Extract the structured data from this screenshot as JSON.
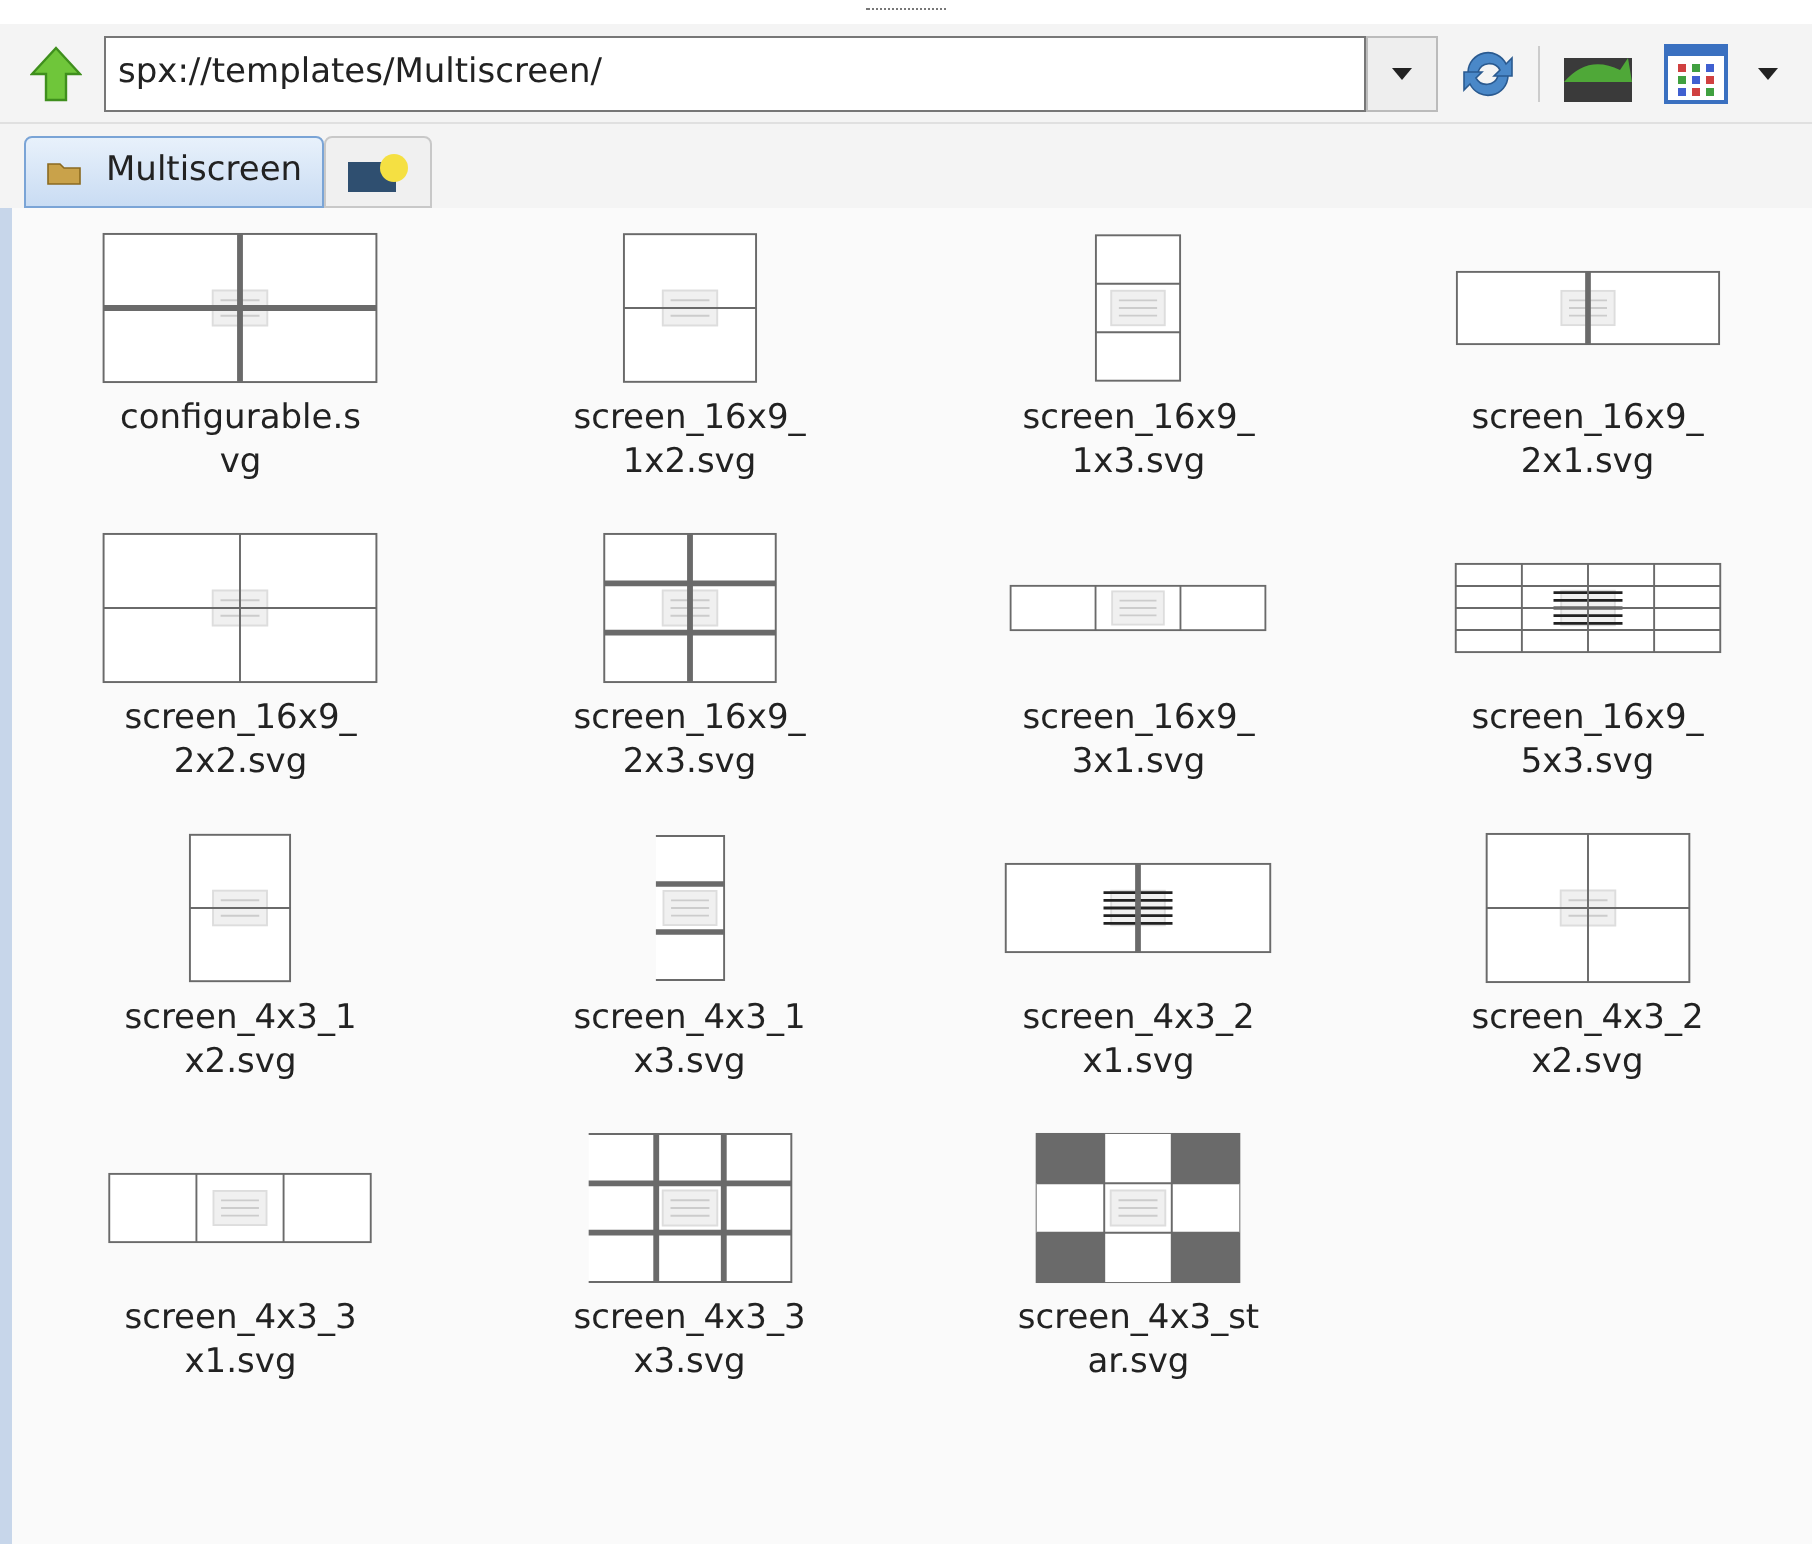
{
  "toolbar": {
    "path": "spx://templates/Multiscreen/"
  },
  "tabs": [
    {
      "label": "Multiscreen",
      "selected": true,
      "kind": "text"
    },
    {
      "selected": false,
      "kind": "icon"
    }
  ],
  "files": [
    {
      "name_lines": [
        "configurable.s",
        "vg"
      ],
      "kind": "configurable"
    },
    {
      "name_lines": [
        "screen_16x9_",
        "1x2.svg"
      ],
      "kind": "wide12"
    },
    {
      "name_lines": [
        "screen_16x9_",
        "1x3.svg"
      ],
      "kind": "wide13"
    },
    {
      "name_lines": [
        "screen_16x9_",
        "2x1.svg"
      ],
      "kind": "wide21"
    },
    {
      "name_lines": [
        "screen_16x9_",
        "2x2.svg"
      ],
      "kind": "wide22"
    },
    {
      "name_lines": [
        "screen_16x9_",
        "2x3.svg"
      ],
      "kind": "wide23"
    },
    {
      "name_lines": [
        "screen_16x9_",
        "3x1.svg"
      ],
      "kind": "wide31"
    },
    {
      "name_lines": [
        "screen_16x9_",
        "5x3.svg"
      ],
      "kind": "wide53"
    },
    {
      "name_lines": [
        "screen_4x3_1",
        "x2.svg"
      ],
      "kind": "std12"
    },
    {
      "name_lines": [
        "screen_4x3_1",
        "x3.svg"
      ],
      "kind": "std13"
    },
    {
      "name_lines": [
        "screen_4x3_2",
        "x1.svg"
      ],
      "kind": "std21"
    },
    {
      "name_lines": [
        "screen_4x3_2",
        "x2.svg"
      ],
      "kind": "std22"
    },
    {
      "name_lines": [
        "screen_4x3_3",
        "x1.svg"
      ],
      "kind": "std31"
    },
    {
      "name_lines": [
        "screen_4x3_3",
        "x3.svg"
      ],
      "kind": "std33"
    },
    {
      "name_lines": [
        "screen_4x3_st",
        "ar.svg"
      ],
      "kind": "star"
    }
  ]
}
